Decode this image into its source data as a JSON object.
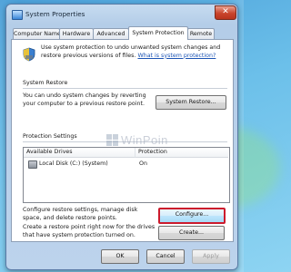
{
  "window": {
    "title": "System Properties",
    "close_glyph": "✕",
    "icon": "computer-icon"
  },
  "tabs": [
    {
      "label": "Computer Name",
      "active": false
    },
    {
      "label": "Hardware",
      "active": false
    },
    {
      "label": "Advanced",
      "active": false
    },
    {
      "label": "System Protection",
      "active": true
    },
    {
      "label": "Remote",
      "active": false
    }
  ],
  "intro": {
    "icon": "shield-icon",
    "text": "Use system protection to undo unwanted system changes and restore previous versions of files.",
    "link": "What is system protection?"
  },
  "system_restore": {
    "heading": "System Restore",
    "description": "You can undo system changes by reverting your computer to a previous restore point.",
    "button": "System Restore..."
  },
  "protection_settings": {
    "heading": "Protection Settings",
    "columns": [
      "Available Drives",
      "Protection"
    ],
    "rows": [
      {
        "drive": "Local Disk (C:) (System)",
        "protection": "On",
        "icon": "disk-icon"
      }
    ],
    "configure_text": "Configure restore settings, manage disk space, and delete restore points.",
    "configure_button": "Configure...",
    "create_text": "Create a restore point right now for the drives that have system protection turned on.",
    "create_button": "Create..."
  },
  "watermark": {
    "text": "WinPoin"
  },
  "footer": {
    "ok": "OK",
    "cancel": "Cancel",
    "apply": "Apply"
  },
  "colors": {
    "focus_border": "#cc1a2c",
    "link": "#1c54b4",
    "desktop": "#4a9fd8"
  }
}
